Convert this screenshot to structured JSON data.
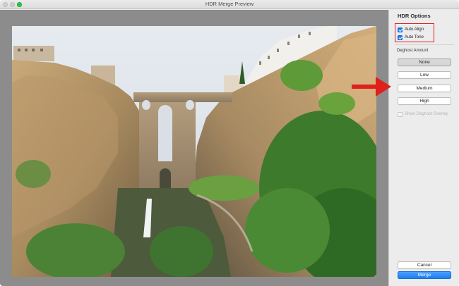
{
  "window": {
    "title": "HDR Merge Preview"
  },
  "sidebar": {
    "heading": "HDR Options",
    "auto_align": {
      "label": "Auto Align",
      "checked": true
    },
    "auto_tone": {
      "label": "Auto Tone",
      "checked": true
    },
    "deghost_label": "Deghost Amount",
    "deghost_options": [
      {
        "label": "None",
        "selected": true
      },
      {
        "label": "Low",
        "selected": false
      },
      {
        "label": "Medium",
        "selected": false
      },
      {
        "label": "High",
        "selected": false
      }
    ],
    "show_overlay": {
      "label": "Show Deghost Overlay",
      "checked": false,
      "enabled": false
    },
    "cancel_label": "Cancel",
    "merge_label": "Merge"
  },
  "colors": {
    "accent": "#1f7cf0",
    "annotation": "#e0201c",
    "preview_bg": "#8c8c8c"
  }
}
